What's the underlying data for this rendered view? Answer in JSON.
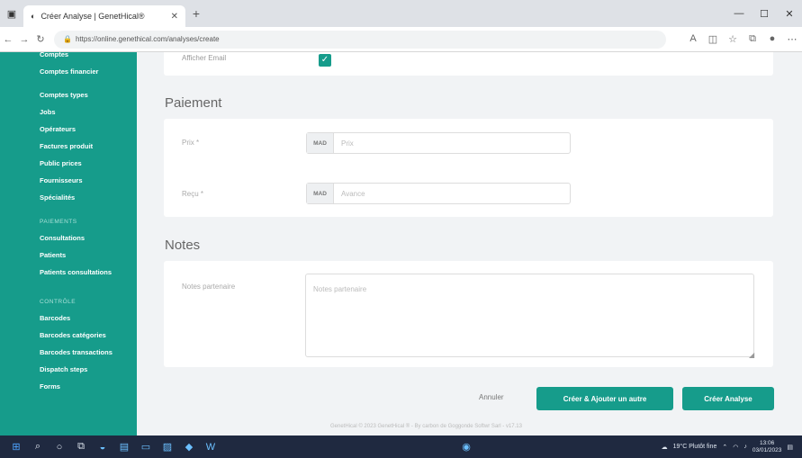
{
  "browser": {
    "tab_title": "Créer Analyse | GenetHical®",
    "url": "https://online.genethical.com/analyses/create"
  },
  "sidebar": {
    "items_top": [
      "Comptes",
      "Comptes financier",
      "Comptes types",
      "Jobs",
      "Opérateurs",
      "Factures produit",
      "Public prices",
      "Fournisseurs",
      "Spécialités"
    ],
    "section_paiements": "Paiements",
    "items_paiements": [
      "Consultations",
      "Patients",
      "Patients consultations"
    ],
    "section_config": "Contrôle",
    "items_config": [
      "Barcodes",
      "Barcodes catégories",
      "Barcodes transactions",
      "Dispatch steps",
      "Forms"
    ]
  },
  "form": {
    "checkbox_label": "Afficher Email",
    "payment_title": "Paiement",
    "price_label": "Prix *",
    "price_addon": "MAD",
    "price_placeholder": "Prix",
    "deposit_label": "Reçu *",
    "deposit_addon": "MAD",
    "deposit_placeholder": "Avance",
    "notes_title": "Notes",
    "notes_label": "Notes partenaire",
    "notes_placeholder": "Notes partenaire",
    "cancel_label": "Annuler",
    "create_add_label": "Créer & Ajouter un autre",
    "create_label": "Créer Analyse"
  },
  "footer_text": "GenetHical © 2023 GenetHical ® - By carbon de Goggonde Softwr Sarl - v17.13",
  "taskbar": {
    "weather": "19°C Plutôt fine",
    "time": "13:06",
    "date": "03/01/2023"
  },
  "colors": {
    "accent": "#169c8b",
    "taskbar": "#1f2940"
  }
}
